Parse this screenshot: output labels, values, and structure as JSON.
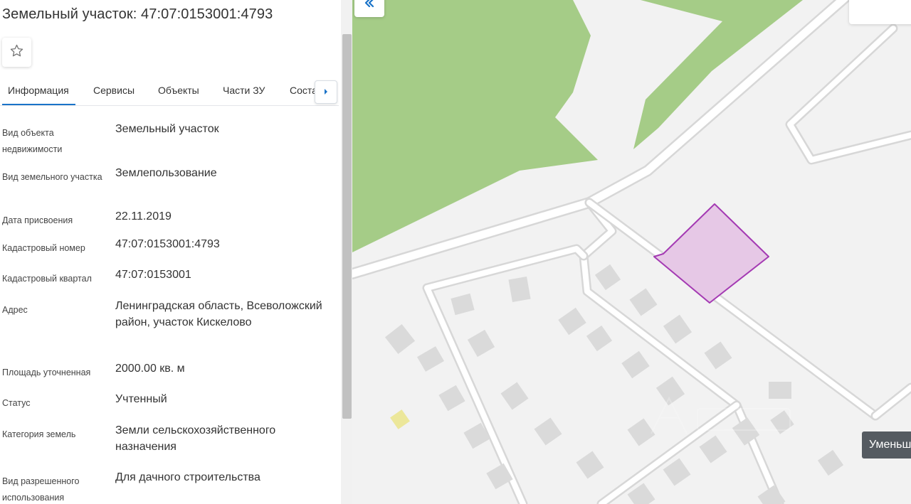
{
  "panel": {
    "title": "Земельный участок: 47:07:0153001:4793",
    "tabs": [
      {
        "label": "Информация",
        "active": true
      },
      {
        "label": "Сервисы",
        "active": false
      },
      {
        "label": "Объекты",
        "active": false
      },
      {
        "label": "Части ЗУ",
        "active": false
      },
      {
        "label": "Соста",
        "active": false
      }
    ],
    "rows": [
      {
        "label": "Вид объекта недвижимости",
        "value": "Земельный участок"
      },
      {
        "label": "Вид земельного участка",
        "value": "Землепользование"
      },
      {
        "label": "Дата присвоения",
        "value": "22.11.2019"
      },
      {
        "label": "Кадастровый номер",
        "value": "47:07:0153001:4793"
      },
      {
        "label": "Кадастровый квартал",
        "value": "47:07:0153001"
      },
      {
        "label": "Адрес",
        "value": "Ленинградская область, Всеволожский район, участок Кискелово"
      },
      {
        "label": "Площадь уточненная",
        "value": "2000.00 кв. м"
      },
      {
        "label": "Статус",
        "value": "Учтенный"
      },
      {
        "label": "Категория земель",
        "value": "Земли сельскохозяйственного назначения"
      },
      {
        "label": "Вид разрешенного использования",
        "value": "Для дачного строительства"
      }
    ]
  },
  "icons": {
    "favorite": "star-outline-icon",
    "tabs_next": "caret-right-icon",
    "collapse": "double-chevron-left-icon"
  },
  "map": {
    "tooltip": "Уменьш",
    "colors": {
      "forest": "#a5cc87",
      "background": "#f2f2f2",
      "road_outline": "#d9d9d9",
      "building": "#dadada",
      "parcel_fill": "#e6c8e6",
      "parcel_stroke": "#a43ab3",
      "highlight_building": "#ece79a",
      "accent": "#1a73c8"
    }
  }
}
